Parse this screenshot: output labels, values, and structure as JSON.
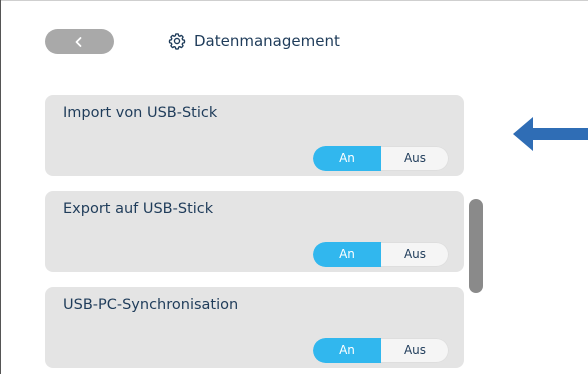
{
  "header": {
    "title": "Datenmanagement",
    "back_icon": "chevron-left-icon",
    "title_icon": "gear-icon"
  },
  "settings": [
    {
      "label": "Import von USB-Stick",
      "on_label": "An",
      "off_label": "Aus",
      "selected": "An"
    },
    {
      "label": "Export auf USB-Stick",
      "on_label": "An",
      "off_label": "Aus",
      "selected": "An"
    },
    {
      "label": "USB-PC-Synchronisation",
      "on_label": "An",
      "off_label": "Aus",
      "selected": "An"
    }
  ],
  "colors": {
    "accent": "#31b7ee",
    "text": "#1f3c5a",
    "card_bg": "#e4e4e4",
    "arrow": "#2f6db5"
  },
  "annotation": {
    "icon": "arrow-left-icon"
  }
}
